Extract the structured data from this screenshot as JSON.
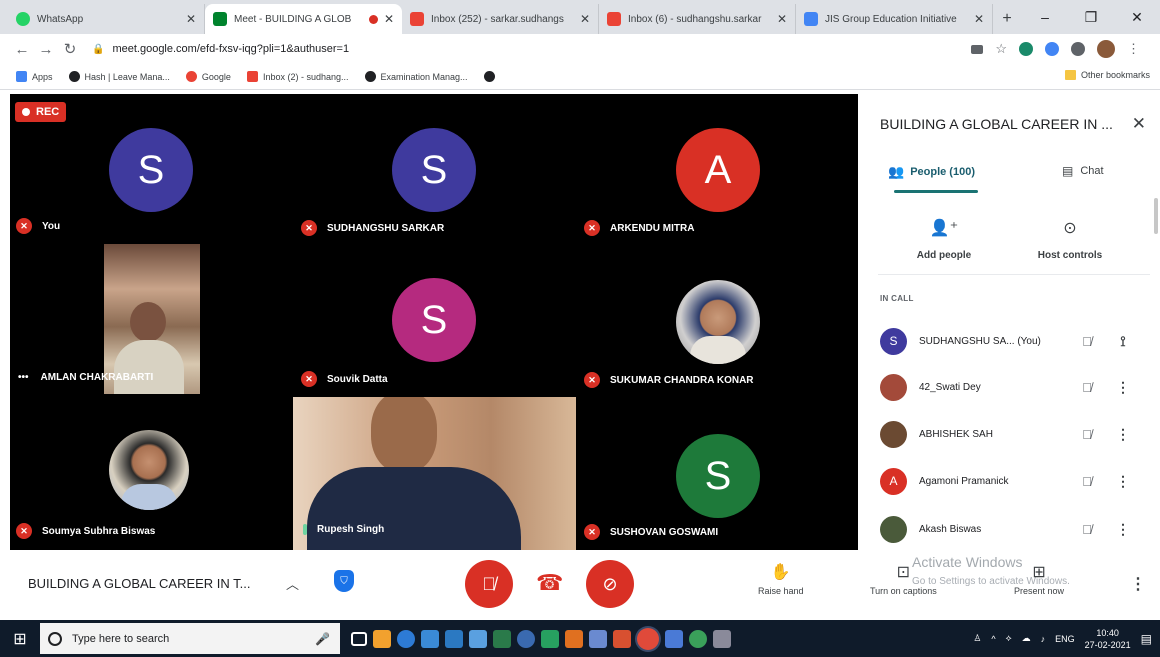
{
  "browser": {
    "tabs": [
      {
        "label": "WhatsApp",
        "color": "#25d366",
        "active": false
      },
      {
        "label": "Meet - BUILDING A GLOB",
        "color": "#00832d",
        "active": true
      },
      {
        "label": "Inbox (252) - sarkar.sudhangs",
        "color": "#ea4335",
        "active": false
      },
      {
        "label": "Inbox (6) - sudhangshu.sarkar",
        "color": "#ea4335",
        "active": false
      },
      {
        "label": "JIS Group Education Initiative",
        "color": "#4285f4",
        "active": false
      }
    ],
    "new_tab": "+",
    "window_controls": [
      "–",
      "❐",
      "✕"
    ],
    "url": "meet.google.com/efd-fxsv-iqg?pli=1&authuser=1",
    "bookmarks": [
      {
        "label": "Apps",
        "color": "#4285f4"
      },
      {
        "label": "Hash | Leave Mana...",
        "color": "#202124"
      },
      {
        "label": "Google",
        "color": "#ea4335"
      },
      {
        "label": "Inbox (2) - sudhang...",
        "color": "#ea4335"
      },
      {
        "label": "Examination Manag...",
        "color": "#202124"
      }
    ],
    "other_bookmarks": "Other bookmarks"
  },
  "meet": {
    "rec_label": "REC",
    "meeting_title": "BUILDING A GLOBAL CAREER IN T...",
    "participants_grid": [
      {
        "name": "You",
        "initial": "S",
        "color": "#3f3a9e"
      },
      {
        "name": "SUDHANGSHU SARKAR",
        "initial": "S",
        "color": "#3f3a9e"
      },
      {
        "name": "ARKENDU MITRA",
        "initial": "A",
        "color": "#d93025"
      },
      {
        "name": "AMLAN CHAKRABARTI",
        "initial": "",
        "color": ""
      },
      {
        "name": "Souvik Datta",
        "initial": "S",
        "color": "#b52a7f"
      },
      {
        "name": "SUKUMAR CHANDRA KONAR",
        "initial": "",
        "color": ""
      },
      {
        "name": "Soumya Subhra Biswas",
        "initial": "",
        "color": ""
      },
      {
        "name": "Rupesh Singh",
        "initial": "",
        "color": ""
      },
      {
        "name": "SUSHOVAN GOSWAMI",
        "initial": "S",
        "color": "#1e7a3a"
      }
    ],
    "amlan_more": "•••"
  },
  "panel": {
    "title": "BUILDING A GLOBAL CAREER IN ...",
    "tab_people": "People (100)",
    "tab_chat": "Chat",
    "add_people": "Add people",
    "host_controls": "Host controls",
    "in_call": "IN CALL",
    "people": [
      {
        "name": "SUDHANGSHU SA... (You)",
        "initial": "S",
        "color": "#3f3a9e"
      },
      {
        "name": "42_Swati Dey",
        "initial": "",
        "color": "#a34a3a"
      },
      {
        "name": "ABHISHEK SAH",
        "initial": "",
        "color": "#6b4a32"
      },
      {
        "name": "Agamoni Pramanick",
        "initial": "A",
        "color": "#d93025"
      },
      {
        "name": "Akash Biswas",
        "initial": "",
        "color": "#4a5a3a"
      }
    ]
  },
  "controls": {
    "raise_hand": "Raise hand",
    "captions": "Turn on captions",
    "present": "Present now",
    "watermark_title": "Activate Windows",
    "watermark_sub": "Go to Settings to activate Windows."
  },
  "taskbar": {
    "search_placeholder": "Type here to search",
    "lang": "ENG",
    "time": "10:40",
    "date": "27-02-2021"
  }
}
